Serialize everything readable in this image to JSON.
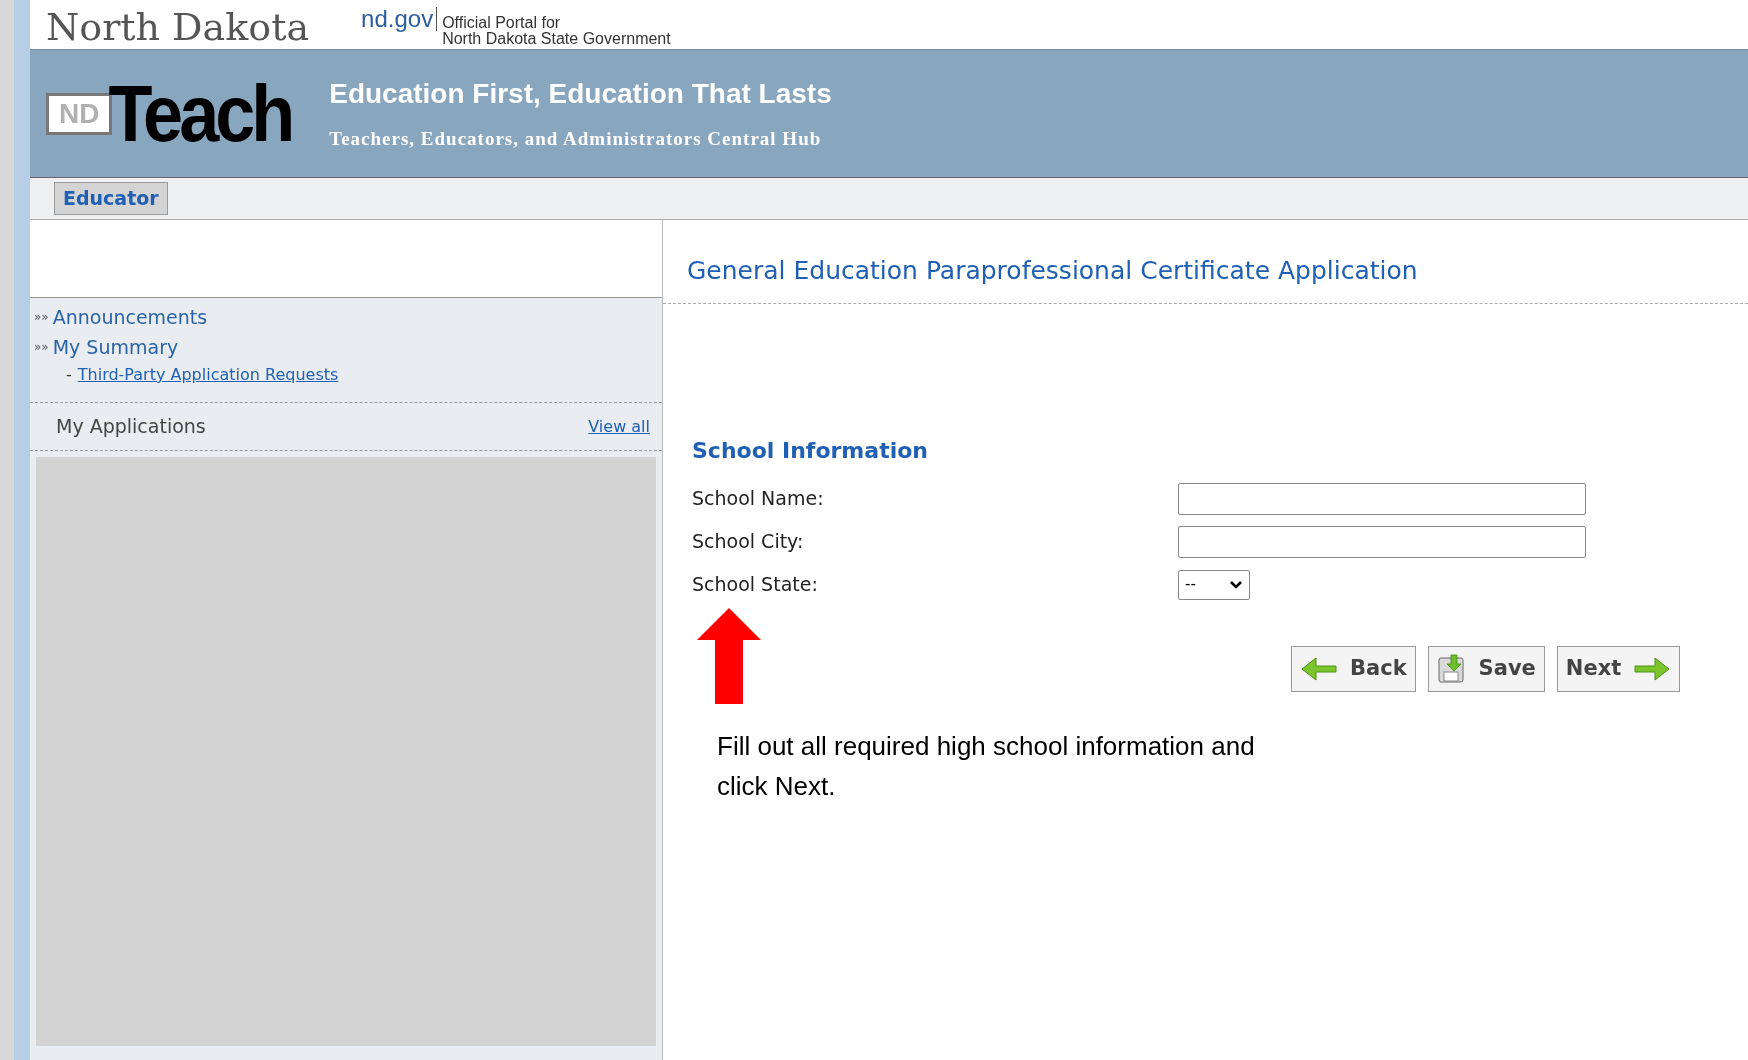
{
  "top_bar": {
    "state_name": "North Dakota",
    "portal_domain": "nd.gov",
    "portal_caption": [
      "Official Portal for",
      "North Dakota State Government"
    ]
  },
  "banner": {
    "logo_badge": "ND",
    "logo_word": "Teach",
    "title": "Education First, Education That Lasts",
    "subtitle": "Teachers, Educators, and Administrators Central Hub"
  },
  "tabs": [
    {
      "label": "Educator",
      "selected": true
    }
  ],
  "sidebar": {
    "items": [
      {
        "label": "Announcements",
        "kind": "section",
        "marker": "»»"
      },
      {
        "label": "My Summary",
        "kind": "section",
        "marker": "»»"
      },
      {
        "label": "Third-Party Application Requests",
        "kind": "sublink",
        "marker": "-"
      }
    ],
    "applications": {
      "heading": "My Applications",
      "link": "View all"
    }
  },
  "main": {
    "title": "General Education Paraprofessional Certificate Application",
    "section": "School Information",
    "fields": [
      {
        "label": "School Name:",
        "kind": "text"
      },
      {
        "label": "School City:",
        "kind": "text"
      },
      {
        "label": "School State:",
        "kind": "select",
        "value": "--"
      }
    ],
    "buttons": [
      {
        "label": "Back",
        "kind": "back"
      },
      {
        "label": "Save",
        "kind": "save"
      },
      {
        "label": "Next",
        "kind": "next"
      }
    ],
    "note": "Fill out all required high school information and click Next."
  }
}
